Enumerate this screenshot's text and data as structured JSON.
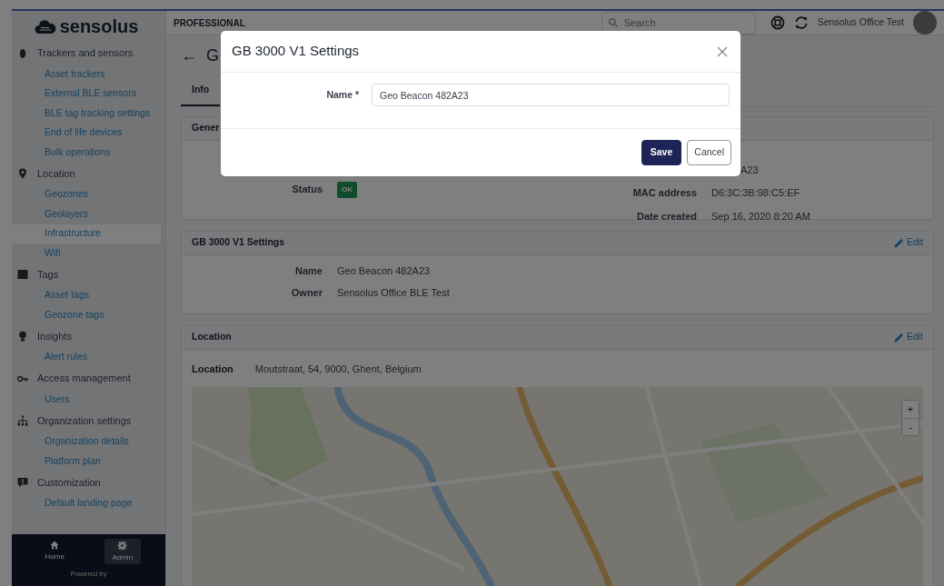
{
  "sidebar": {
    "logo": "sensolus",
    "sections": [
      {
        "label": "Trackers and sensors",
        "children": [
          {
            "label": "Asset trackers",
            "selected": false
          },
          {
            "label": "External BLE sensors",
            "selected": false
          },
          {
            "label": "BLE tag tracking settings",
            "selected": false
          },
          {
            "label": "End of life devices",
            "selected": false
          },
          {
            "label": "Bulk operations",
            "selected": false
          }
        ]
      },
      {
        "label": "Location",
        "children": [
          {
            "label": "Geozones",
            "selected": false
          },
          {
            "label": "Geolayers",
            "selected": false
          },
          {
            "label": "Infrastructure",
            "selected": true
          },
          {
            "label": "Wifi",
            "selected": false
          }
        ]
      },
      {
        "label": "Tags",
        "children": [
          {
            "label": "Asset tags",
            "selected": false
          },
          {
            "label": "Geozone tags",
            "selected": false
          }
        ]
      },
      {
        "label": "Insights",
        "children": [
          {
            "label": "Alert rules",
            "selected": false
          }
        ]
      },
      {
        "label": "Access management",
        "children": [
          {
            "label": "Users",
            "selected": false
          }
        ]
      },
      {
        "label": "Organization settings",
        "children": [
          {
            "label": "Organization details",
            "selected": false
          },
          {
            "label": "Platform plan",
            "selected": false
          }
        ]
      },
      {
        "label": "Customization",
        "children": [
          {
            "label": "Default landing page",
            "selected": false
          }
        ]
      }
    ],
    "footer": {
      "items": [
        {
          "label": "Home",
          "selected": false
        },
        {
          "label": "Admin",
          "selected": true
        }
      ],
      "powered_by": "Powered by"
    }
  },
  "topbar": {
    "plan": "PROFESSIONAL",
    "search": {
      "placeholder": "Search"
    },
    "org_name": "Sensolus Office Test"
  },
  "page": {
    "back_arrow": "←",
    "title": "G",
    "tabs": [
      {
        "label": "Info",
        "selected": true
      }
    ]
  },
  "general_card": {
    "title": "Gener",
    "left_fields": [
      {
        "label": "Status",
        "value": "OK",
        "kind": "badge"
      }
    ],
    "right_fields": [
      {
        "value": "A23"
      },
      {
        "label": "MAC address",
        "value": "D6:3C:3B:98:C5:EF"
      },
      {
        "label": "Date created",
        "value": "Sep 16, 2020 8:20 AM"
      }
    ]
  },
  "settings_card": {
    "title": "GB 3000 V1 Settings",
    "edit": "Edit",
    "fields": [
      {
        "label": "Name",
        "value": "Geo Beacon 482A23"
      },
      {
        "label": "Owner",
        "value": "Sensolus Office BLE Test"
      }
    ]
  },
  "location_card": {
    "title": "Location",
    "edit": "Edit",
    "label": "Location",
    "value": "Moutstraat, 54, 9000, Ghent, Belgium",
    "map": {
      "zoom_in": "+",
      "zoom_out": "-"
    }
  },
  "modal": {
    "title": "GB 3000 V1 Settings",
    "fields": [
      {
        "label": "Name *",
        "value": "Geo Beacon 482A23"
      }
    ],
    "buttons": [
      {
        "label": "Save",
        "kind": "primary"
      },
      {
        "label": "Cancel",
        "kind": "secondary"
      }
    ]
  }
}
